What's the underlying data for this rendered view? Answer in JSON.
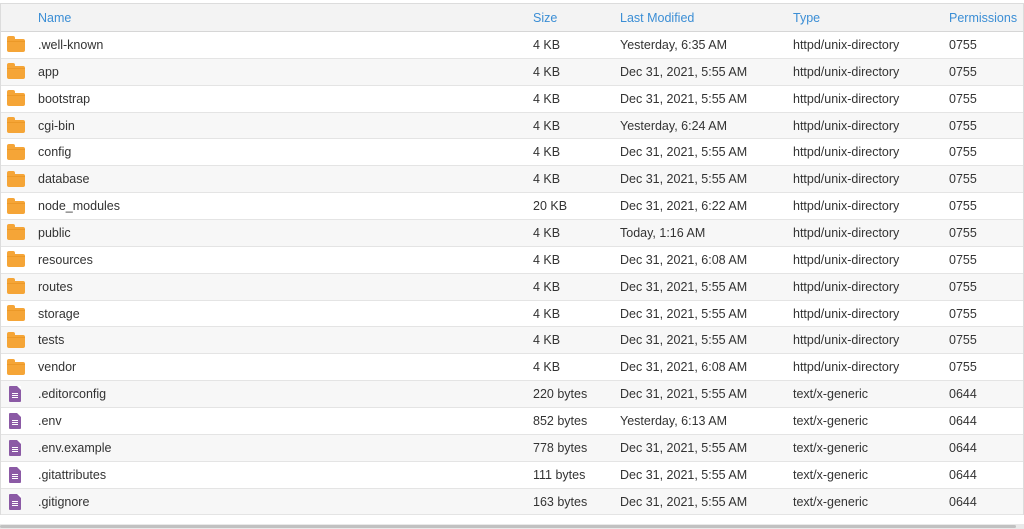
{
  "columns": {
    "name": "Name",
    "size": "Size",
    "modified": "Last Modified",
    "type": "Type",
    "permissions": "Permissions"
  },
  "colors": {
    "header_text": "#3b8ed5",
    "folder_icon": "#f5a537",
    "file_icon": "#8b5aa5"
  },
  "rows": [
    {
      "icon": "folder-icon",
      "name": ".well-known",
      "size": "4 KB",
      "modified": "Yesterday, 6:35 AM",
      "type": "httpd/unix-directory",
      "permissions": "0755"
    },
    {
      "icon": "folder-icon",
      "name": "app",
      "size": "4 KB",
      "modified": "Dec 31, 2021, 5:55 AM",
      "type": "httpd/unix-directory",
      "permissions": "0755"
    },
    {
      "icon": "folder-icon",
      "name": "bootstrap",
      "size": "4 KB",
      "modified": "Dec 31, 2021, 5:55 AM",
      "type": "httpd/unix-directory",
      "permissions": "0755"
    },
    {
      "icon": "folder-icon",
      "name": "cgi-bin",
      "size": "4 KB",
      "modified": "Yesterday, 6:24 AM",
      "type": "httpd/unix-directory",
      "permissions": "0755"
    },
    {
      "icon": "folder-icon",
      "name": "config",
      "size": "4 KB",
      "modified": "Dec 31, 2021, 5:55 AM",
      "type": "httpd/unix-directory",
      "permissions": "0755"
    },
    {
      "icon": "folder-icon",
      "name": "database",
      "size": "4 KB",
      "modified": "Dec 31, 2021, 5:55 AM",
      "type": "httpd/unix-directory",
      "permissions": "0755"
    },
    {
      "icon": "folder-icon",
      "name": "node_modules",
      "size": "20 KB",
      "modified": "Dec 31, 2021, 6:22 AM",
      "type": "httpd/unix-directory",
      "permissions": "0755"
    },
    {
      "icon": "folder-icon",
      "name": "public",
      "size": "4 KB",
      "modified": "Today, 1:16 AM",
      "type": "httpd/unix-directory",
      "permissions": "0755"
    },
    {
      "icon": "folder-icon",
      "name": "resources",
      "size": "4 KB",
      "modified": "Dec 31, 2021, 6:08 AM",
      "type": "httpd/unix-directory",
      "permissions": "0755"
    },
    {
      "icon": "folder-icon",
      "name": "routes",
      "size": "4 KB",
      "modified": "Dec 31, 2021, 5:55 AM",
      "type": "httpd/unix-directory",
      "permissions": "0755"
    },
    {
      "icon": "folder-icon",
      "name": "storage",
      "size": "4 KB",
      "modified": "Dec 31, 2021, 5:55 AM",
      "type": "httpd/unix-directory",
      "permissions": "0755"
    },
    {
      "icon": "folder-icon",
      "name": "tests",
      "size": "4 KB",
      "modified": "Dec 31, 2021, 5:55 AM",
      "type": "httpd/unix-directory",
      "permissions": "0755"
    },
    {
      "icon": "folder-icon",
      "name": "vendor",
      "size": "4 KB",
      "modified": "Dec 31, 2021, 6:08 AM",
      "type": "httpd/unix-directory",
      "permissions": "0755"
    },
    {
      "icon": "file-icon",
      "name": ".editorconfig",
      "size": "220 bytes",
      "modified": "Dec 31, 2021, 5:55 AM",
      "type": "text/x-generic",
      "permissions": "0644"
    },
    {
      "icon": "file-icon",
      "name": ".env",
      "size": "852 bytes",
      "modified": "Yesterday, 6:13 AM",
      "type": "text/x-generic",
      "permissions": "0644"
    },
    {
      "icon": "file-icon",
      "name": ".env.example",
      "size": "778 bytes",
      "modified": "Dec 31, 2021, 5:55 AM",
      "type": "text/x-generic",
      "permissions": "0644"
    },
    {
      "icon": "file-icon",
      "name": ".gitattributes",
      "size": "111 bytes",
      "modified": "Dec 31, 2021, 5:55 AM",
      "type": "text/x-generic",
      "permissions": "0644"
    },
    {
      "icon": "file-icon",
      "name": ".gitignore",
      "size": "163 bytes",
      "modified": "Dec 31, 2021, 5:55 AM",
      "type": "text/x-generic",
      "permissions": "0644"
    }
  ]
}
